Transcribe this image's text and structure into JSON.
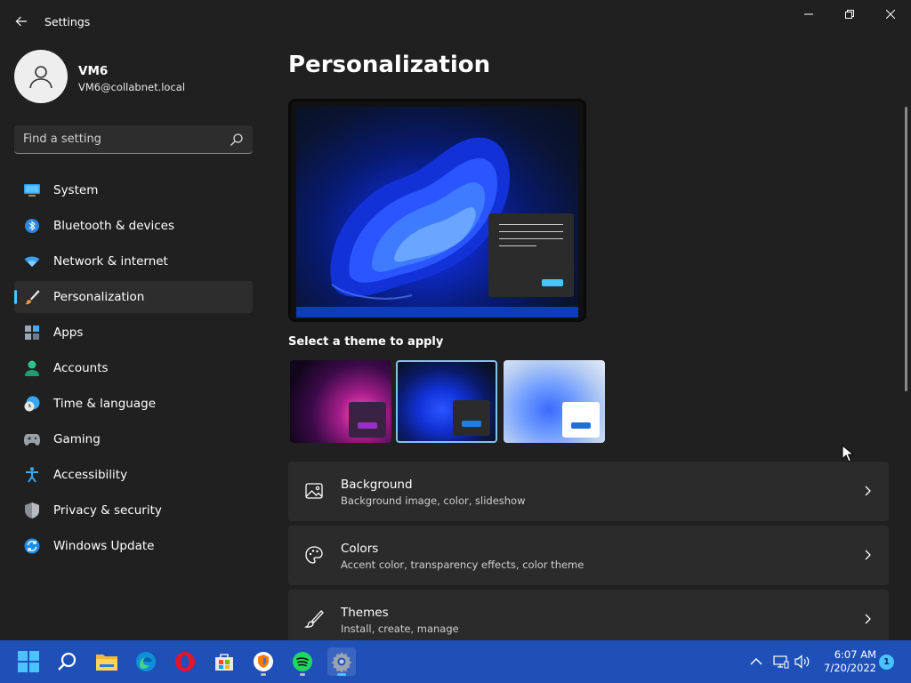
{
  "window": {
    "title": "Settings"
  },
  "user": {
    "name": "VM6",
    "email": "VM6@collabnet.local"
  },
  "search": {
    "placeholder": "Find a setting"
  },
  "sidebar": {
    "items": [
      {
        "label": "System",
        "icon": "monitor-icon",
        "active": false
      },
      {
        "label": "Bluetooth & devices",
        "icon": "bluetooth-icon",
        "active": false
      },
      {
        "label": "Network & internet",
        "icon": "wifi-icon",
        "active": false
      },
      {
        "label": "Personalization",
        "icon": "paintbrush-icon",
        "active": true
      },
      {
        "label": "Apps",
        "icon": "apps-icon",
        "active": false
      },
      {
        "label": "Accounts",
        "icon": "person-icon",
        "active": false
      },
      {
        "label": "Time & language",
        "icon": "clock-globe-icon",
        "active": false
      },
      {
        "label": "Gaming",
        "icon": "gamepad-icon",
        "active": false
      },
      {
        "label": "Accessibility",
        "icon": "accessibility-icon",
        "active": false
      },
      {
        "label": "Privacy & security",
        "icon": "shield-icon",
        "active": false
      },
      {
        "label": "Windows Update",
        "icon": "update-icon",
        "active": false
      }
    ]
  },
  "main": {
    "title": "Personalization",
    "theme_section_label": "Select a theme to apply",
    "themes": [
      {
        "name": "glow",
        "selected": false
      },
      {
        "name": "windows-dark",
        "selected": true
      },
      {
        "name": "windows-light",
        "selected": false
      }
    ],
    "settings": [
      {
        "title": "Background",
        "desc": "Background image, color, slideshow",
        "icon": "image-icon"
      },
      {
        "title": "Colors",
        "desc": "Accent color, transparency effects, color theme",
        "icon": "palette-icon"
      },
      {
        "title": "Themes",
        "desc": "Install, create, manage",
        "icon": "brush-icon"
      }
    ]
  },
  "taskbar": {
    "apps": [
      "start-icon",
      "search-icon",
      "file-explorer-icon",
      "edge-icon",
      "opera-icon",
      "store-icon",
      "vpn-icon",
      "spotify-icon",
      "settings-icon"
    ],
    "active_app": "settings-icon",
    "time": "6:07 AM",
    "date": "7/20/2022",
    "notification_count": "1"
  },
  "colors": {
    "accent": "#4cc2ff",
    "background": "#202020",
    "card": "#2b2b2b",
    "taskbar": "#1e50b8"
  }
}
